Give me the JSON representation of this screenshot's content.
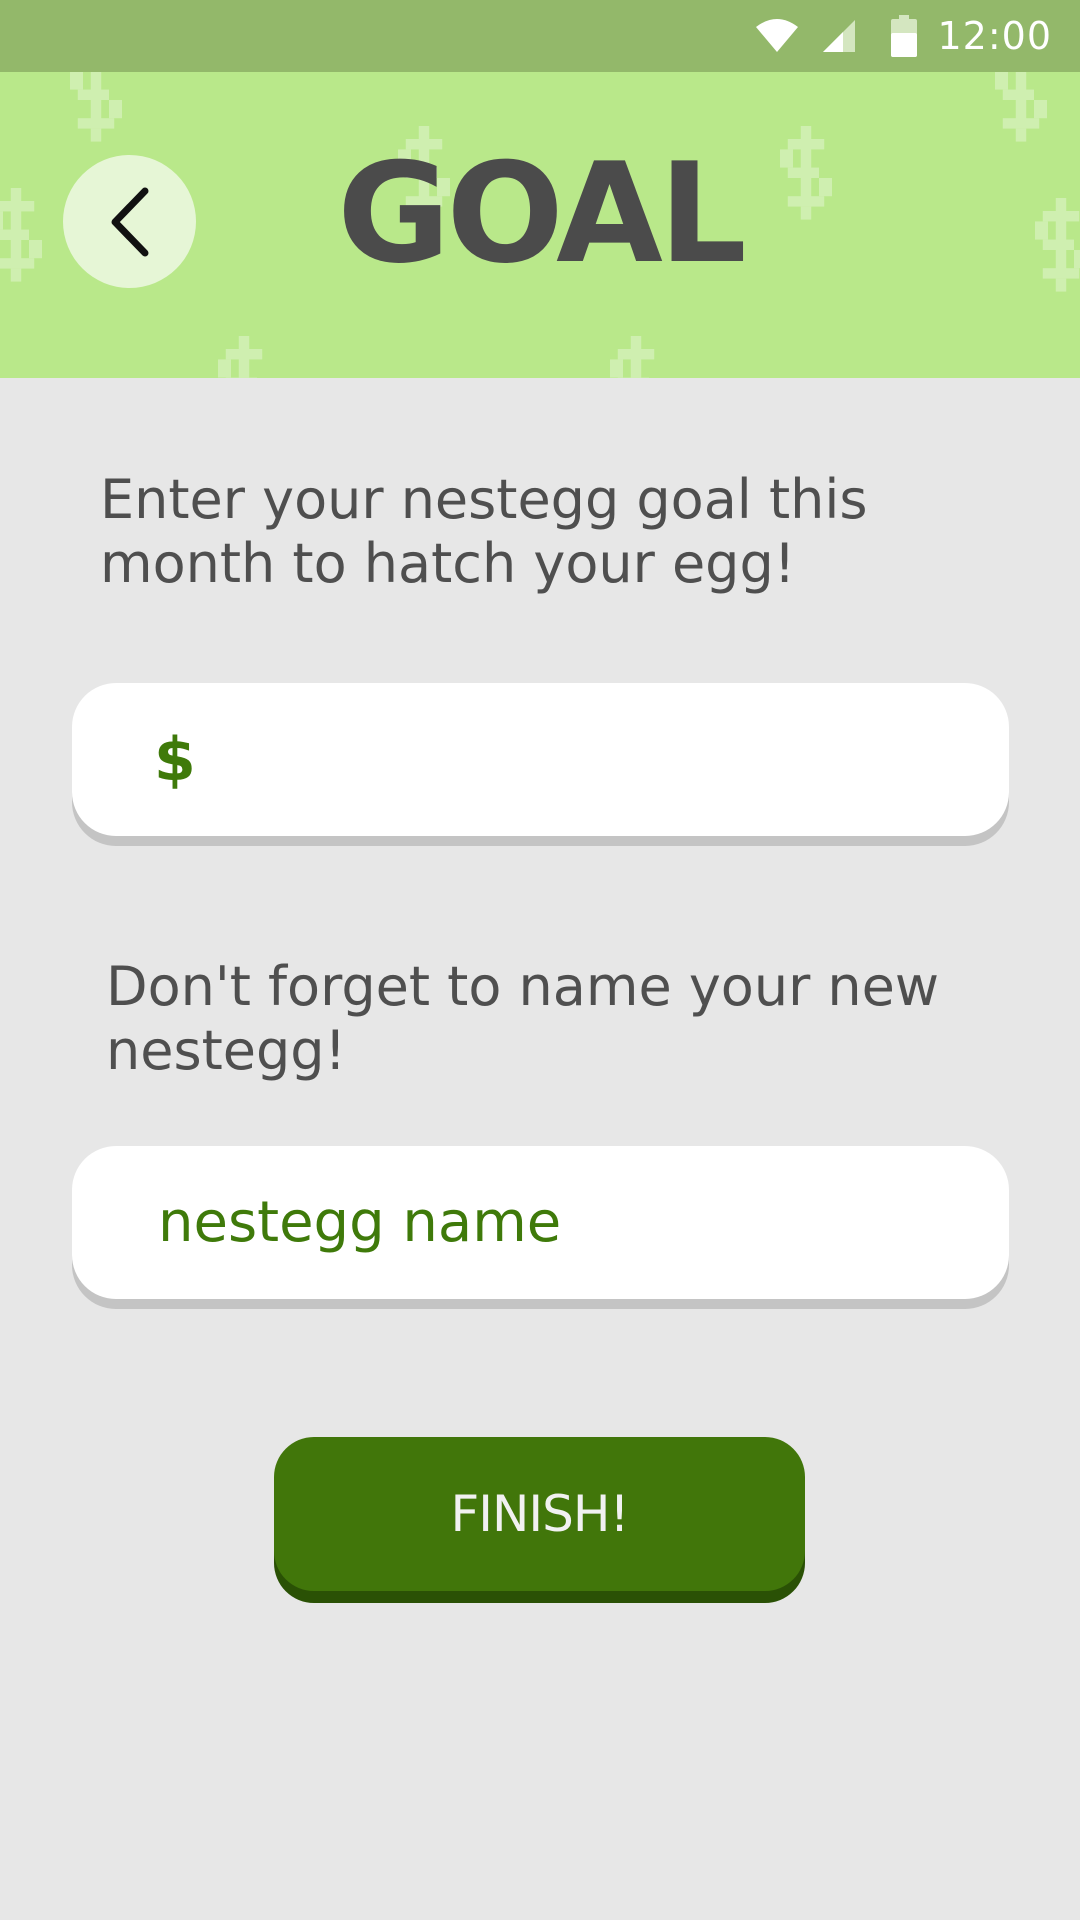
{
  "status_bar": {
    "time": "12:00",
    "icons": [
      "wifi-icon",
      "signal-icon",
      "battery-icon"
    ]
  },
  "header": {
    "title": "GOAL",
    "back_icon": "chevron-left-icon",
    "background_pattern": "dollar-sign-pattern"
  },
  "goal_section": {
    "prompt": "Enter your nestegg goal this month to hatch your egg!",
    "currency_symbol": "$",
    "amount_value": ""
  },
  "name_section": {
    "prompt": "Don't forget to name your new nestegg!",
    "name_placeholder": "nestegg name"
  },
  "finish_button": {
    "label": "FINISH!"
  },
  "colors": {
    "status_bar": "#93b86a",
    "header": "#b9e88a",
    "background": "#e7e7e7",
    "accent_green": "#41760a",
    "title_text": "#4b4b4b"
  }
}
